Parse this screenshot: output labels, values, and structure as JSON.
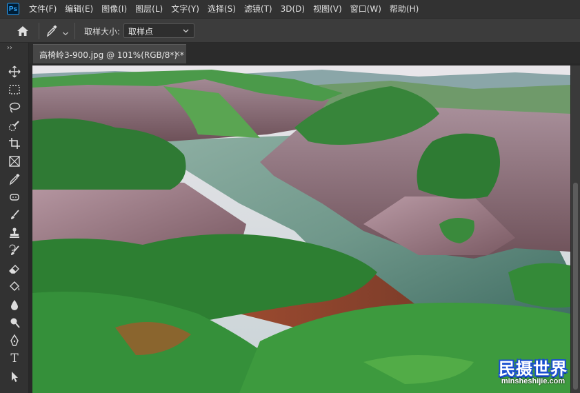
{
  "app": {
    "logo_text": "Ps",
    "menu": [
      "文件(F)",
      "编辑(E)",
      "图像(I)",
      "图层(L)",
      "文字(Y)",
      "选择(S)",
      "滤镜(T)",
      "3D(D)",
      "视图(V)",
      "窗口(W)",
      "帮助(H)"
    ]
  },
  "options_bar": {
    "sample_size_label": "取样大小:",
    "sample_size_value": "取样点"
  },
  "toolbar": {
    "collapse_label": "››",
    "tools": [
      "move-tool-icon",
      "marquee-tool-icon",
      "lasso-tool-icon",
      "quick-selection-tool-icon",
      "crop-tool-icon",
      "frame-tool-icon",
      "eyedropper-tool-icon",
      "spot-healing-tool-icon",
      "brush-tool-icon",
      "clone-stamp-tool-icon",
      "history-brush-tool-icon",
      "eraser-tool-icon",
      "paint-bucket-tool-icon",
      "blur-tool-icon",
      "dodge-tool-icon",
      "pen-tool-icon",
      "type-tool-icon",
      "path-selection-tool-icon"
    ],
    "type_tool_glyph": "T"
  },
  "document": {
    "tab_title": "高椅岭3-900.jpg @ 101%(RGB/8*) *",
    "close_glyph": "×"
  },
  "watermark": {
    "title": "民摄世界",
    "subtitle": "minsheshijie.com"
  },
  "colors": {
    "accent": "#31a8ff",
    "watermark_blue": "#1a4fd0"
  }
}
